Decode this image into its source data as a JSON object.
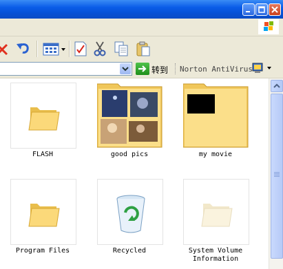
{
  "address": {
    "go_label": "转到"
  },
  "toolbars": {
    "norton_label": "Norton AntiVirus"
  },
  "files": [
    {
      "name": "FLASH",
      "type": "folder"
    },
    {
      "name": "good pics",
      "type": "folder-thumbnails"
    },
    {
      "name": "my movie",
      "type": "folder-movie"
    },
    {
      "name": "Program Files",
      "type": "folder"
    },
    {
      "name": "Recycled",
      "type": "recycle-bin"
    },
    {
      "name": "System Volume Information",
      "type": "folder-hidden"
    }
  ],
  "colors": {
    "title_bar": "#0a5ce8",
    "folder_yellow": "#f8d775",
    "chrome": "#ece9d8"
  }
}
